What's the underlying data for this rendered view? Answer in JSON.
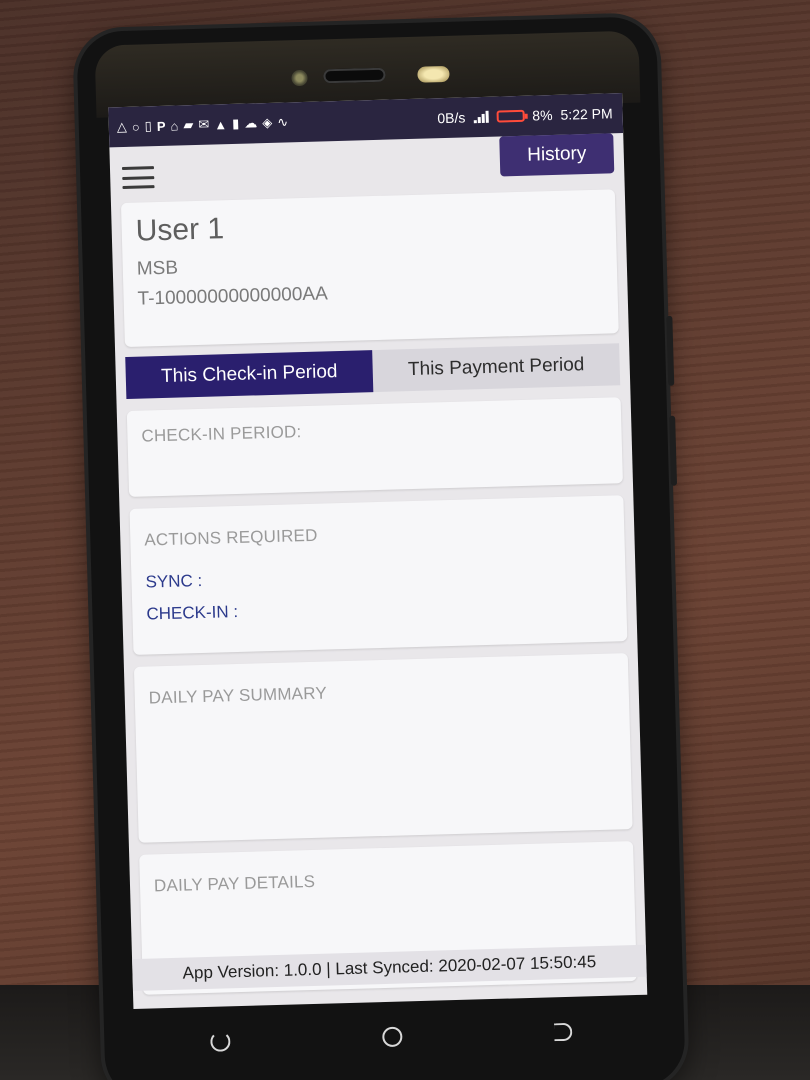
{
  "status_bar": {
    "left_icons": [
      "warning-icon",
      "circle-icon",
      "battery-saver-icon",
      "p-icon",
      "shirt-icon",
      "photo-icon",
      "mail-icon",
      "alert-icon",
      "phone-icon",
      "cloud-icon",
      "shield-icon",
      "pulse-icon"
    ],
    "data_rate": "0B/s",
    "battery_percent": "8%",
    "time": "5:22 PM",
    "battery_color": "#ff4b3a"
  },
  "header": {
    "history_label": "History",
    "accent_color": "#3e2f72"
  },
  "user": {
    "name": "User 1",
    "org": "MSB",
    "id": "T-10000000000000AA"
  },
  "tabs": [
    {
      "label": "This Check-in Period",
      "active": true
    },
    {
      "label": "This Payment Period",
      "active": false
    }
  ],
  "sections": {
    "checkin_period_title": "CHECK-IN PERIOD:",
    "actions_title": "ACTIONS REQUIRED",
    "sync_label": "SYNC :",
    "checkin_label": "CHECK-IN :",
    "daily_pay_summary_title": "DAILY PAY SUMMARY",
    "daily_pay_details_title": "DAILY PAY DETAILS"
  },
  "footer": {
    "text": "App Version: 1.0.0 | Last Synced: 2020-02-07 15:50:45"
  }
}
